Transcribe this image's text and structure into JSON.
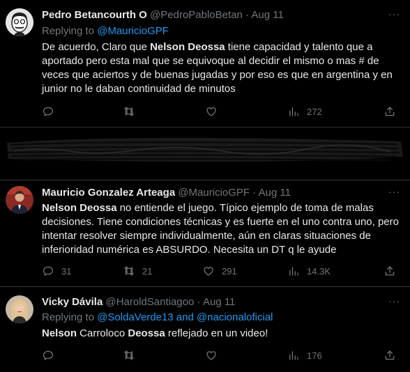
{
  "tweets": [
    {
      "name": "Pedro Betancourth O",
      "handle": "@PedroPabloBetan",
      "sep": "·",
      "date": "Aug 11",
      "reply_prefix": "Replying to",
      "reply_to": "@MauricioGPF",
      "body": {
        "p1": "De acuerdo, Claro que ",
        "b1": "Nelson Deossa",
        "p2": " tiene capacidad y talento que a aportado pero esta mal que se equivoque al decidir el mismo o mas # de veces que aciertos y de buenas jugadas y por eso es que en argentina y en junior no le daban continuidad de minutos"
      },
      "views": "272"
    },
    {
      "name": "Mauricio Gonzalez Arteaga",
      "handle": "@MauricioGPF",
      "sep": "·",
      "date": "Aug 11",
      "body": {
        "b1": "Nelson Deossa",
        "p1": " no entiende el juego.  Típico ejemplo de toma de malas decisiones.  Tiene condiciones técnicas y es fuerte en el uno contra uno, pero intentar resolver siempre individualmente, aún en claras situaciones de inferioridad numérica es ABSURDO. Necesita un DT q le ayude"
      },
      "replies": "31",
      "retweets": "21",
      "likes": "291",
      "views": "14.3K"
    },
    {
      "name": "Vicky Dávila",
      "handle": "@HaroldSantiagoo",
      "sep": "·",
      "date": "Aug 11",
      "reply_prefix": "Replying to",
      "reply_to": "@SoldaVerde13 and @nacionaloficial",
      "body": {
        "b1": "Nelson",
        "p1": " Carroloco ",
        "b2": "Deossa",
        "p2": " reflejado en un video!"
      },
      "views": "176"
    }
  ],
  "more_glyph": "···",
  "icons": [
    "reply-icon",
    "retweet-icon",
    "like-icon",
    "views-icon",
    "share-icon",
    "more-icon"
  ],
  "colors": {
    "background": "#000000",
    "text": "#e7e9ea",
    "muted": "#71767b",
    "link": "#1d9bf0",
    "divider": "#2f3336"
  }
}
